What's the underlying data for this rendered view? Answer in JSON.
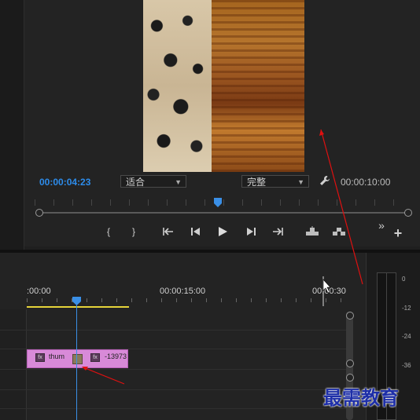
{
  "monitor": {
    "current_time": "00:00:04:23",
    "total_time": "00:00:10:00",
    "fit_dropdown": "适合",
    "quality_dropdown": "完整",
    "controls": [
      "mark-in",
      "mark-out",
      "go-to-in",
      "step-back",
      "play",
      "step-forward",
      "go-to-out",
      "lift",
      "extract",
      "more",
      "add"
    ]
  },
  "timeline": {
    "ruler_labels": [
      ":00:00",
      "00:00:15:00",
      "00:00:30"
    ],
    "clip": {
      "name": "thum",
      "name2": "-13973"
    }
  },
  "meters": {
    "labels": [
      "0",
      "-12",
      "-24",
      "-36"
    ]
  },
  "watermark": "最需教育",
  "colors": {
    "accent": "#2d8ceb",
    "clip": "#d88ad8",
    "work_area": "#e6d43a",
    "annotation_arrow": "#e01010"
  }
}
